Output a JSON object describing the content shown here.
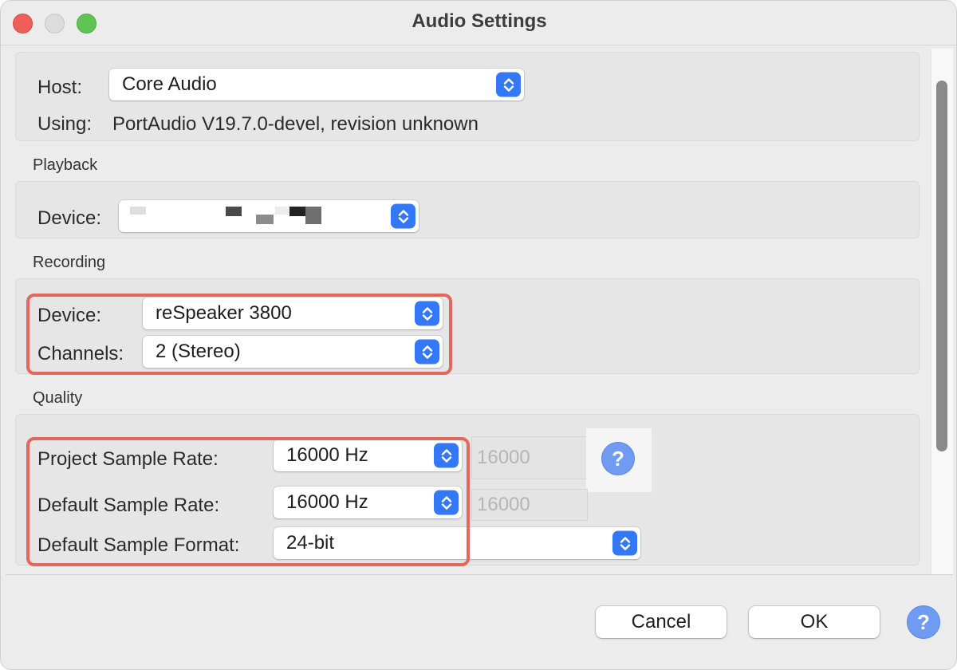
{
  "window": {
    "title": "Audio Settings"
  },
  "interface": {
    "host_label": "Host:",
    "host_value": "Core Audio",
    "using_label": "Using:",
    "using_value": "PortAudio V19.7.0-devel, revision unknown"
  },
  "playback": {
    "section_title": "Playback",
    "device_label": "Device:",
    "device_value": ""
  },
  "recording": {
    "section_title": "Recording",
    "device_label": "Device:",
    "device_value": "reSpeaker 3800",
    "channels_label": "Channels:",
    "channels_value": "2 (Stereo)"
  },
  "quality": {
    "section_title": "Quality",
    "project_rate_label": "Project Sample Rate:",
    "project_rate_value": "16000 Hz",
    "project_rate_field": "16000",
    "default_rate_label": "Default Sample Rate:",
    "default_rate_value": "16000 Hz",
    "default_rate_field": "16000",
    "format_label": "Default Sample Format:",
    "format_value": "24-bit"
  },
  "buttons": {
    "cancel": "Cancel",
    "ok": "OK"
  },
  "help_icon_glyph": "?",
  "colors": {
    "accent": "#3478f6",
    "highlight": "#e2675c",
    "help": "#6f9bf3"
  }
}
